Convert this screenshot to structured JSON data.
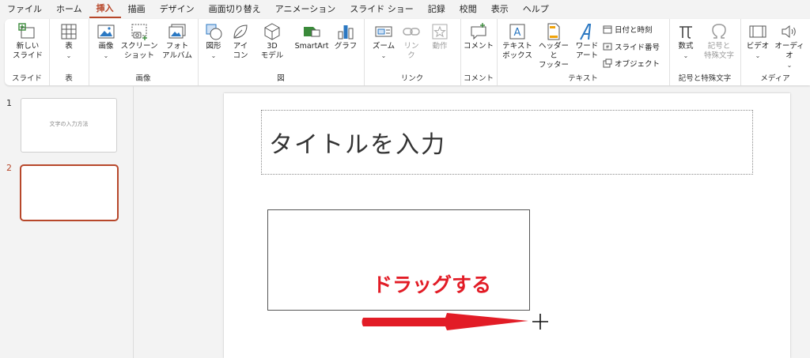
{
  "menu": [
    "ファイル",
    "ホーム",
    "挿入",
    "描画",
    "デザイン",
    "画面切り替え",
    "アニメーション",
    "スライド ショー",
    "記録",
    "校閲",
    "表示",
    "ヘルプ"
  ],
  "menu_active": "挿入",
  "ribbon": {
    "slide_group": {
      "new_slide_l1": "新しい",
      "new_slide_l2": "スライド",
      "label": "スライド"
    },
    "table_group": {
      "table": "表",
      "label": "表"
    },
    "image_group": {
      "image": "画像",
      "screenshot_l1": "スクリーン",
      "screenshot_l2": "ショット",
      "album_l1": "フォト",
      "album_l2": "アルバム",
      "label": "画像"
    },
    "figure_group": {
      "shape": "図形",
      "icon_l1": "アイ",
      "icon_l2": "コン",
      "model_l1": "3D",
      "model_l2": "モデル",
      "smartart": "SmartArt",
      "graph": "グラフ",
      "label": "図"
    },
    "link_group": {
      "zoom": "ズーム",
      "link_l1": "リン",
      "link_l2": "ク",
      "action": "動作",
      "label": "リンク"
    },
    "comment_group": {
      "comment": "コメント",
      "label": "コメント"
    },
    "text_group": {
      "textbox_l1": "テキスト",
      "textbox_l2": "ボックス",
      "header_l1": "ヘッダーと",
      "header_l2": "フッター",
      "wordart_l1": "ワード",
      "wordart_l2": "アート",
      "datetime": "日付と時刻",
      "slidenum": "スライド番号",
      "object": "オブジェクト",
      "label": "テキスト"
    },
    "symbol_group": {
      "equation": "数式",
      "symbol_l1": "記号と",
      "symbol_l2": "特殊文字",
      "label": "記号と特殊文字"
    },
    "media_group": {
      "video": "ビデオ",
      "audio": "オーディオ",
      "label": "メディア"
    }
  },
  "slides": [
    {
      "number": "1",
      "title": "文字の入力方法"
    },
    {
      "number": "2",
      "title": ""
    }
  ],
  "slide": {
    "title_placeholder": "タイトルを入力"
  },
  "annotation": "ドラッグする",
  "colors": {
    "accent": "#b7472a",
    "annotation": "#e21c26"
  }
}
